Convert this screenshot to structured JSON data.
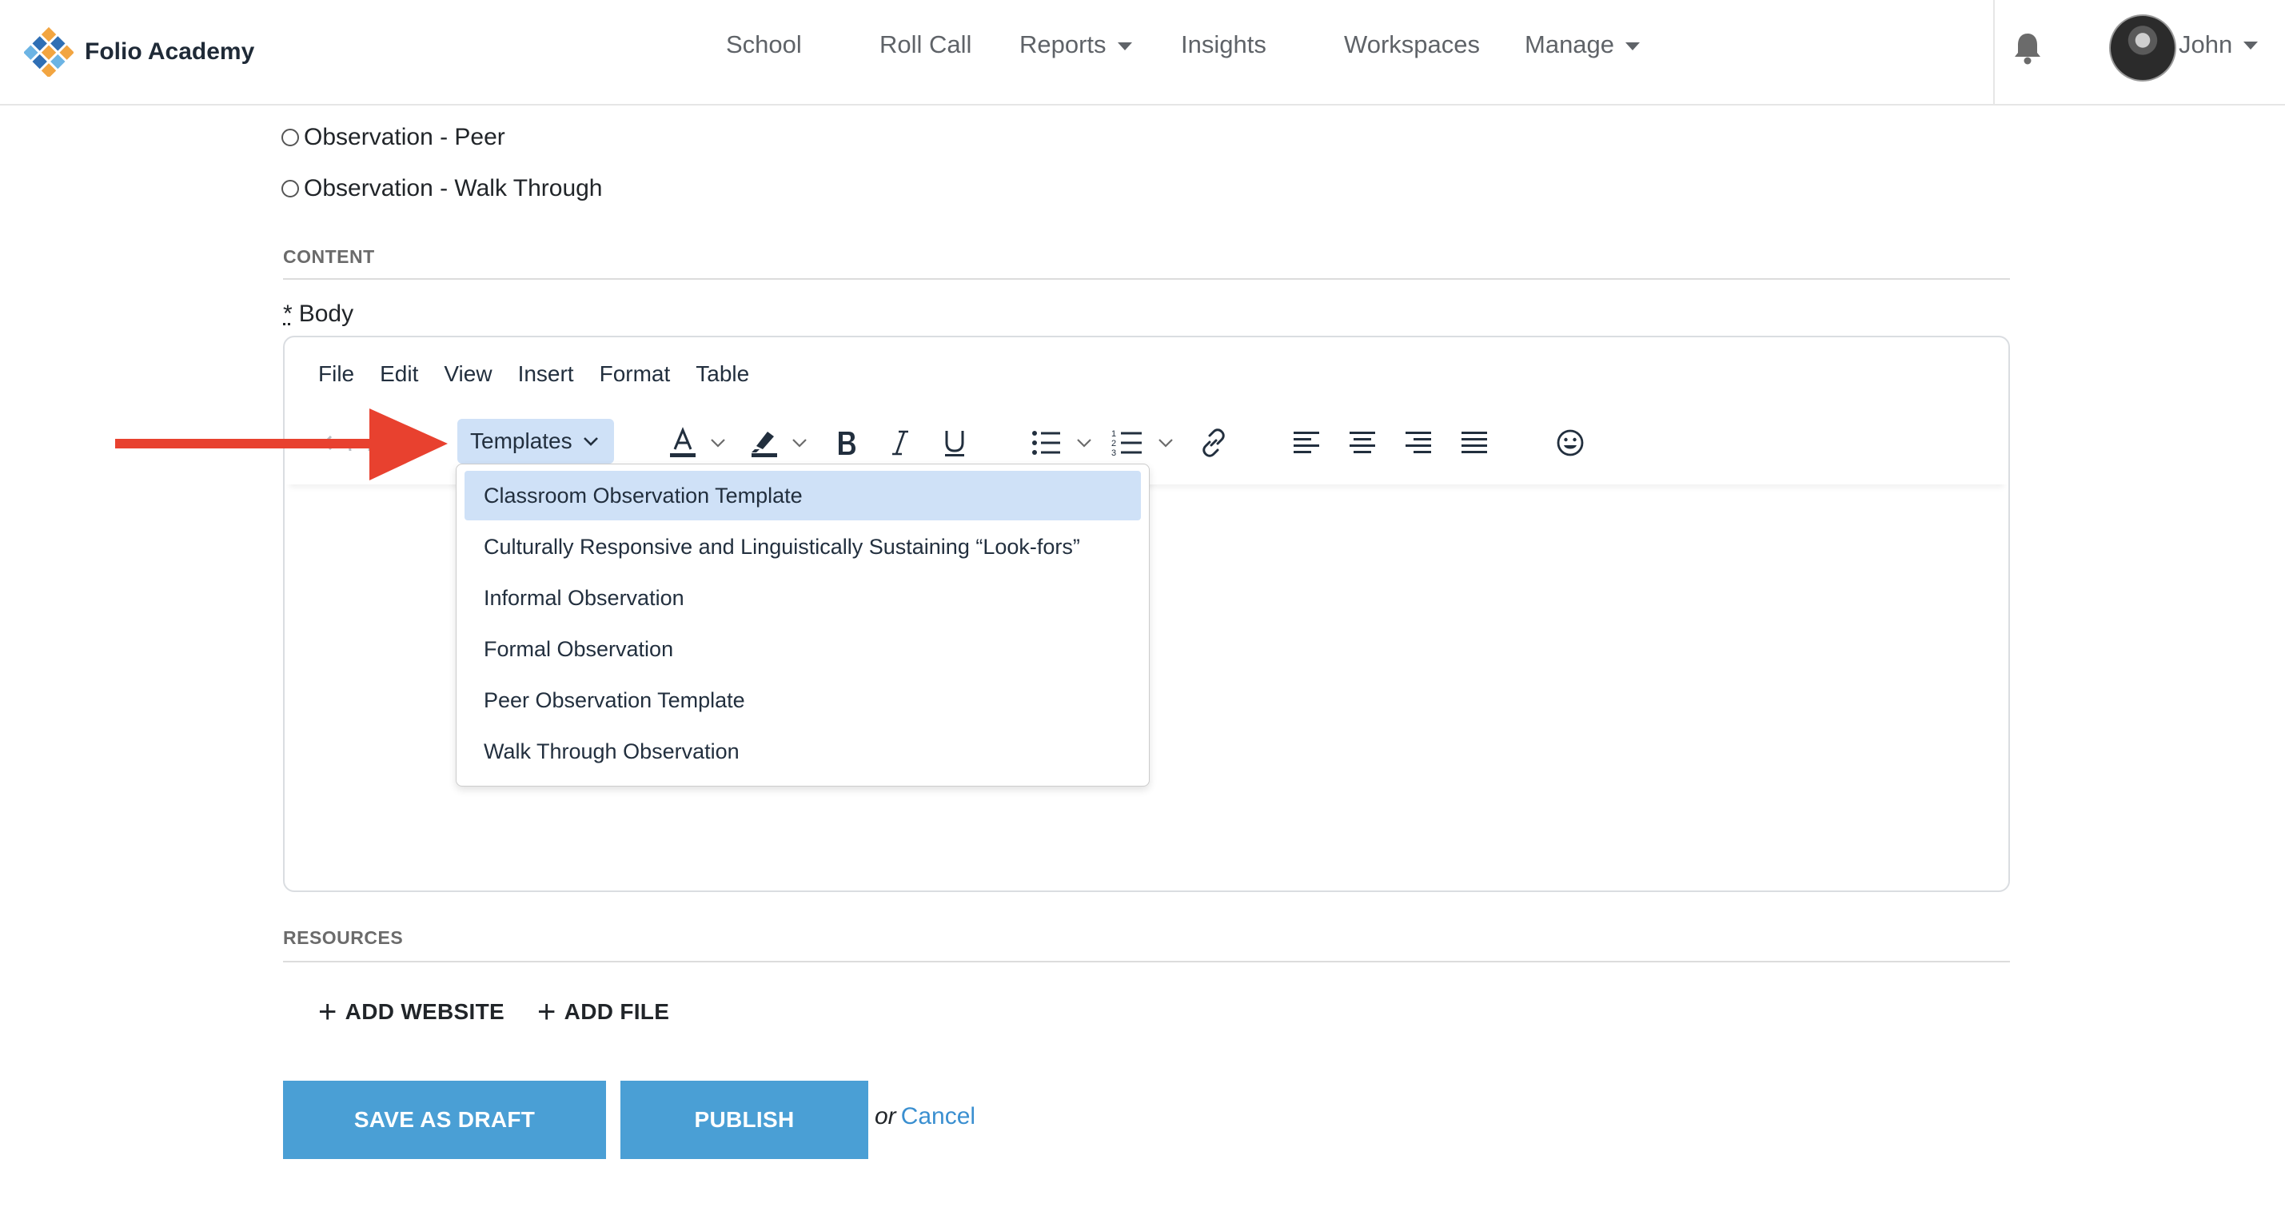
{
  "brand": {
    "name": "Folio Academy",
    "logo_icon": "folio-logo-icon"
  },
  "nav": {
    "items": [
      {
        "label": "School",
        "has_caret": false
      },
      {
        "label": "Roll Call",
        "has_caret": false
      },
      {
        "label": "Reports",
        "has_caret": true
      },
      {
        "label": "Insights",
        "has_caret": false
      },
      {
        "label": "Workspaces",
        "has_caret": false
      },
      {
        "label": "Manage",
        "has_caret": true
      }
    ],
    "notification_icon": "bell-icon",
    "user": {
      "name": "John",
      "avatar_icon": "avatar-photo"
    }
  },
  "form": {
    "observation_options": [
      {
        "label": "Observation - Peer",
        "selected": false
      },
      {
        "label": "Observation - Walk Through",
        "selected": false
      }
    ],
    "content_heading": "CONTENT",
    "body_required_mark": "*",
    "body_label": "Body"
  },
  "editor": {
    "menu": [
      "File",
      "Edit",
      "View",
      "Insert",
      "Format",
      "Table"
    ],
    "templates_button": "Templates",
    "toolbar_icons": [
      "undo-icon",
      "redo-icon",
      "text-color-icon",
      "highlight-color-icon",
      "bold-icon",
      "italic-icon",
      "underline-icon",
      "bullet-list-icon",
      "numbered-list-icon",
      "link-icon",
      "align-left-icon",
      "align-center-icon",
      "align-right-icon",
      "justify-icon",
      "emoji-icon"
    ],
    "templates_menu": [
      {
        "label": "Classroom Observation Template",
        "highlighted": true
      },
      {
        "label": "Culturally Responsive and Linguistically Sustaining “Look-fors”",
        "highlighted": false
      },
      {
        "label": "Informal Observation",
        "highlighted": false
      },
      {
        "label": "Formal Observation",
        "highlighted": false
      },
      {
        "label": "Peer Observation Template",
        "highlighted": false
      },
      {
        "label": "Walk Through Observation",
        "highlighted": false
      }
    ]
  },
  "resources": {
    "heading": "RESOURCES",
    "add_website": "ADD WEBSITE",
    "add_file": "ADD FILE"
  },
  "actions": {
    "save_draft": "SAVE AS DRAFT",
    "publish": "PUBLISH",
    "or_text": "or",
    "cancel": "Cancel"
  },
  "colors": {
    "primary_button": "#4a9fd5",
    "link": "#3a8fd0",
    "menu_highlight": "#cfe1f7",
    "annotation_arrow": "#e8412f"
  }
}
